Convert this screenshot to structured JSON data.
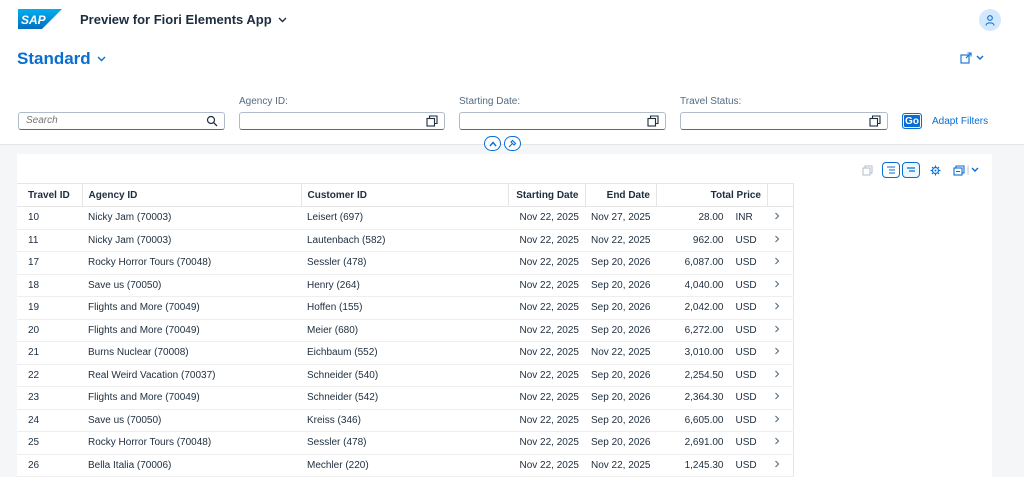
{
  "shell": {
    "logo_text": "SAP",
    "app_title": "Preview for Fiori Elements App"
  },
  "header": {
    "variant": "Standard"
  },
  "filters": {
    "search_placeholder": "Search",
    "agency_label": "Agency ID:",
    "start_label": "Starting Date:",
    "status_label": "Travel Status:",
    "go_label": "Go",
    "adapt_label": "Adapt Filters"
  },
  "table": {
    "columns": [
      "Travel ID",
      "Agency ID",
      "Customer ID",
      "Starting Date",
      "End Date",
      "Total Price"
    ],
    "rows": [
      {
        "id": "10",
        "agency": "Nicky Jam (70003)",
        "customer": "Leisert (697)",
        "start": "Nov 22, 2025",
        "end": "Nov 27, 2025",
        "price": "28.00",
        "cur": "INR"
      },
      {
        "id": "11",
        "agency": "Nicky Jam (70003)",
        "customer": "Lautenbach (582)",
        "start": "Nov 22, 2025",
        "end": "Nov 22, 2025",
        "price": "962.00",
        "cur": "USD"
      },
      {
        "id": "17",
        "agency": "Rocky Horror Tours (70048)",
        "customer": "Sessler (478)",
        "start": "Nov 22, 2025",
        "end": "Sep 20, 2026",
        "price": "6,087.00",
        "cur": "USD"
      },
      {
        "id": "18",
        "agency": "Save us (70050)",
        "customer": "Henry (264)",
        "start": "Nov 22, 2025",
        "end": "Sep 20, 2026",
        "price": "4,040.00",
        "cur": "USD"
      },
      {
        "id": "19",
        "agency": "Flights and More (70049)",
        "customer": "Hoffen (155)",
        "start": "Nov 22, 2025",
        "end": "Sep 20, 2026",
        "price": "2,042.00",
        "cur": "USD"
      },
      {
        "id": "20",
        "agency": "Flights and More (70049)",
        "customer": "Meier (680)",
        "start": "Nov 22, 2025",
        "end": "Sep 20, 2026",
        "price": "6,272.00",
        "cur": "USD"
      },
      {
        "id": "21",
        "agency": "Burns Nuclear (70008)",
        "customer": "Eichbaum (552)",
        "start": "Nov 22, 2025",
        "end": "Nov 22, 2025",
        "price": "3,010.00",
        "cur": "USD"
      },
      {
        "id": "22",
        "agency": "Real Weird Vacation (70037)",
        "customer": "Schneider (540)",
        "start": "Nov 22, 2025",
        "end": "Sep 20, 2026",
        "price": "2,254.50",
        "cur": "USD"
      },
      {
        "id": "23",
        "agency": "Flights and More (70049)",
        "customer": "Schneider (542)",
        "start": "Nov 22, 2025",
        "end": "Sep 20, 2026",
        "price": "2,364.30",
        "cur": "USD"
      },
      {
        "id": "24",
        "agency": "Save us (70050)",
        "customer": "Kreiss (346)",
        "start": "Nov 22, 2025",
        "end": "Sep 20, 2026",
        "price": "6,605.00",
        "cur": "USD"
      },
      {
        "id": "25",
        "agency": "Rocky Horror Tours (70048)",
        "customer": "Sessler (478)",
        "start": "Nov 22, 2025",
        "end": "Sep 20, 2026",
        "price": "2,691.00",
        "cur": "USD"
      },
      {
        "id": "26",
        "agency": "Bella Italia (70006)",
        "customer": "Mechler (220)",
        "start": "Nov 22, 2025",
        "end": "Nov 22, 2025",
        "price": "1,245.30",
        "cur": "USD"
      }
    ]
  },
  "colors": {
    "accent": "#0a6ed1",
    "text": "#1d2d3e"
  }
}
